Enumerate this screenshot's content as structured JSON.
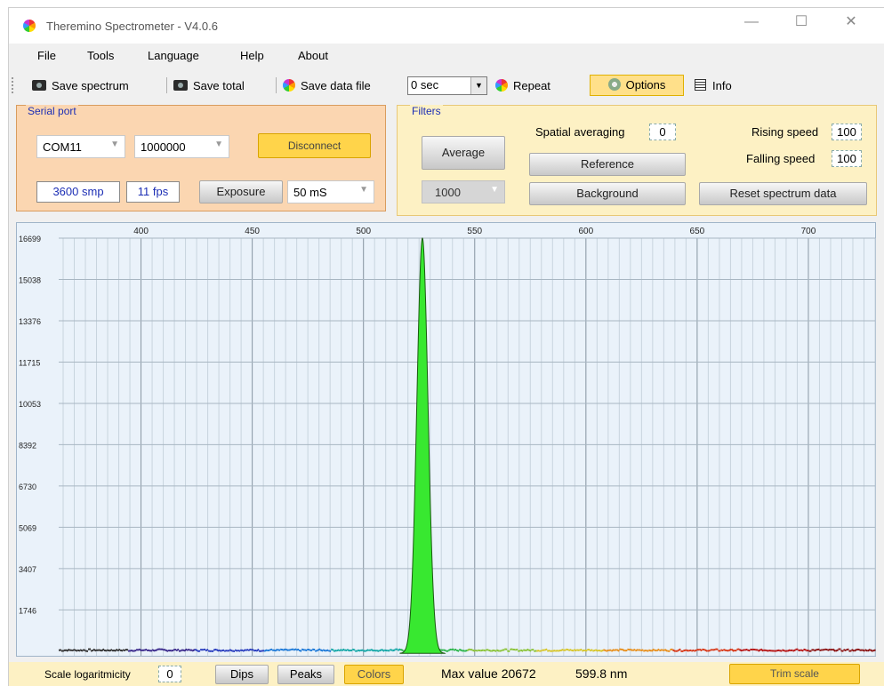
{
  "window": {
    "title": "Theremino Spectrometer - V4.0.6",
    "minimize_glyph": "—",
    "maximize_glyph": "☐",
    "close_glyph": "✕"
  },
  "menu": [
    "File",
    "Tools",
    "Language",
    "Help",
    "About"
  ],
  "toolbar": {
    "save_spectrum": "Save spectrum",
    "save_total": "Save total",
    "save_data_file": "Save data file",
    "interval_value": "0 sec",
    "repeat": "Repeat",
    "options": "Options",
    "info": "Info"
  },
  "serial_port": {
    "group_label": "Serial port",
    "port": "COM11",
    "baud": "1000000",
    "disconnect": "Disconnect",
    "samples": "3600 smp",
    "fps": "11 fps",
    "exposure_label": "Exposure",
    "exposure_value": "50 mS"
  },
  "filters": {
    "group_label": "Filters",
    "average": "Average",
    "average_value": "1000",
    "spatial_averaging_label": "Spatial averaging",
    "spatial_averaging_value": "0",
    "reference": "Reference",
    "background": "Background",
    "rising_speed_label": "Rising speed",
    "rising_speed_value": "100",
    "falling_speed_label": "Falling speed",
    "falling_speed_value": "100",
    "reset": "Reset spectrum data"
  },
  "chart_data": {
    "type": "area",
    "x_ticks": [
      "400",
      "450",
      "500",
      "550",
      "600",
      "650",
      "700"
    ],
    "y_ticks": [
      "16699",
      "15038",
      "13376",
      "11715",
      "10053",
      "8392",
      "6730",
      "5069",
      "3407",
      "1746"
    ],
    "xlim": [
      363,
      730
    ],
    "ylim": [
      -100,
      16699
    ],
    "peak_nm": 526.5,
    "peak_value": 16699,
    "peak_halfwidth_nm": 3.0,
    "baseline_value": 80,
    "fill_color": "#38e830",
    "grid": true
  },
  "status": {
    "scale_log_label": "Scale logaritmicity",
    "scale_log_value": "0",
    "dips": "Dips",
    "peaks": "Peaks",
    "colors": "Colors",
    "max_value": "Max value 20672",
    "max_nm": "599.8 nm",
    "trim_scale": "Trim scale"
  }
}
